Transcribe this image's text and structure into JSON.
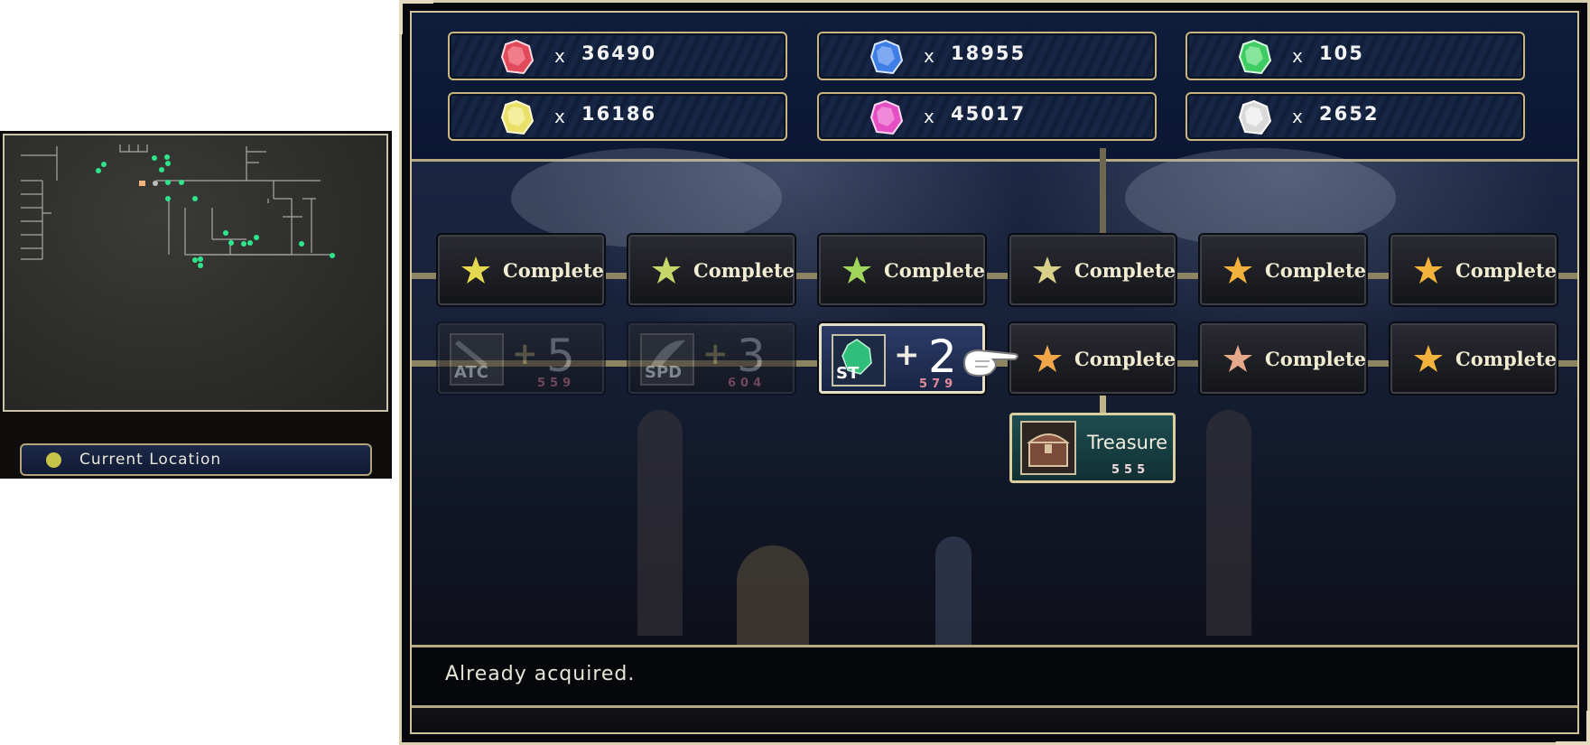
{
  "minimap": {
    "legend_label": "Current Location",
    "legend_dot_color": "#c7c24a",
    "room_marker_color": "#2fe58c"
  },
  "gems": [
    {
      "name": "red-gem",
      "color": "#e04a5a",
      "x_label": "x",
      "count": "36490"
    },
    {
      "name": "blue-gem",
      "color": "#3f7ee6",
      "x_label": "x",
      "count": "18955"
    },
    {
      "name": "green-gem",
      "color": "#3fcc62",
      "x_label": "x",
      "count": "105"
    },
    {
      "name": "yellow-gem",
      "color": "#e9e068",
      "x_label": "x",
      "count": "16186"
    },
    {
      "name": "pink-gem",
      "color": "#e64fc3",
      "x_label": "x",
      "count": "45017"
    },
    {
      "name": "white-gem",
      "color": "#d9d9d9",
      "x_label": "x",
      "count": "2652"
    }
  ],
  "tree": {
    "row1": [
      {
        "label": "Complete",
        "star_color": "#e3d84f"
      },
      {
        "label": "Complete",
        "star_color": "#c7d66b"
      },
      {
        "label": "Complete",
        "star_color": "#9fd65b"
      },
      {
        "label": "Complete",
        "star_color": "#d9cf8a"
      },
      {
        "label": "Complete",
        "star_color": "#f2b23b"
      },
      {
        "label": "Complete",
        "star_color": "#f2b23b"
      }
    ],
    "row2_stats": [
      {
        "badge": "ATC",
        "icon": "sword-icon",
        "plus": "+",
        "value": "5",
        "cost": "559"
      },
      {
        "badge": "SPD",
        "icon": "wing-icon",
        "plus": "+",
        "value": "3",
        "cost": "604"
      },
      {
        "badge": "ST",
        "icon": "green-crystal-icon",
        "plus": "+",
        "value": "2",
        "cost": "579"
      }
    ],
    "row2_complete": [
      {
        "label": "Complete",
        "star_color": "#f2a64a"
      },
      {
        "label": "Complete",
        "star_color": "#e6a88a"
      },
      {
        "label": "Complete",
        "star_color": "#f2b23b"
      }
    ],
    "treasure": {
      "label": "Treasure",
      "cost": "555",
      "icon": "treasure-chest-icon"
    }
  },
  "message": "Already acquired."
}
